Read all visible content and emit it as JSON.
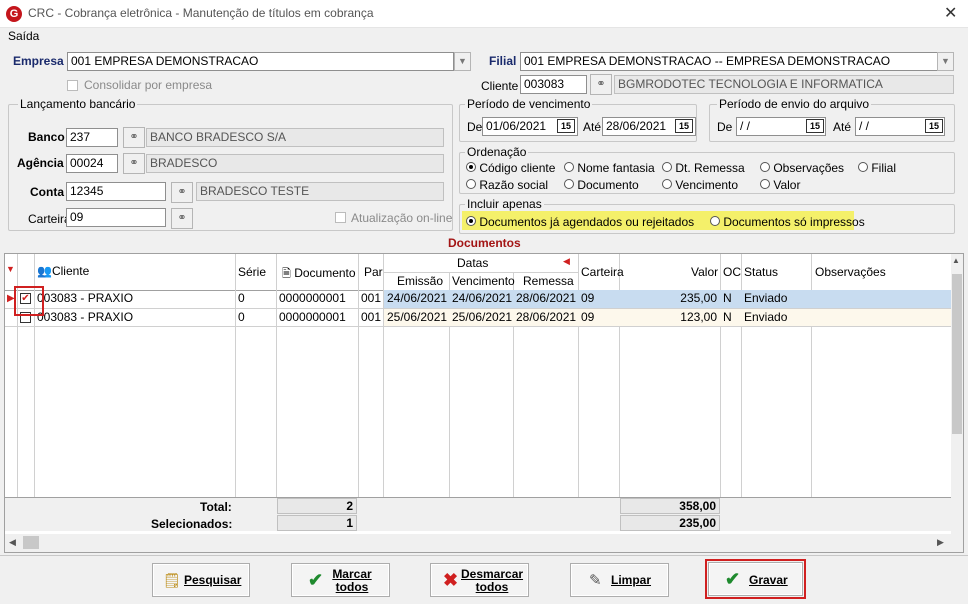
{
  "window": {
    "title": "CRC - Cobrança eletrônica - Manutenção de títulos em cobrança",
    "logo": "G"
  },
  "menu": {
    "saida": "Saída"
  },
  "empresa": {
    "label": "Empresa",
    "value": "001 EMPRESA DEMONSTRACAO",
    "consolidar_label": "Consolidar por empresa"
  },
  "filial": {
    "label": "Filial",
    "value": "001 EMPRESA DEMONSTRACAO -- EMPRESA DEMONSTRACAO"
  },
  "cliente": {
    "label": "Cliente",
    "code": "003083",
    "name": "BGMRODOTEC TECNOLOGIA  E INFORMATICA"
  },
  "lancamento": {
    "legend": "Lançamento bancário",
    "banco_label": "Banco",
    "banco_code": "237",
    "banco_name": "BANCO BRADESCO S/A",
    "agencia_label": "Agência",
    "agencia_code": "00024",
    "agencia_name": "BRADESCO",
    "conta_label": "Conta",
    "conta_code": "12345",
    "conta_name": "BRADESCO TESTE",
    "carteira_label": "Carteira",
    "carteira_code": "09",
    "atualizacao_label": "Atualização on-line"
  },
  "periodo_vencimento": {
    "legend": "Período de vencimento",
    "de_label": "De",
    "de": "01/06/2021",
    "ate_label": "Até",
    "ate": "28/06/2021"
  },
  "periodo_envio": {
    "legend": "Período de envio do arquivo",
    "de_label": "De",
    "de": " / /",
    "ate_label": "Até",
    "ate": " / /"
  },
  "calendar_icon_text": "15",
  "ordenacao": {
    "legend": "Ordenação",
    "options": [
      "Código cliente",
      "Nome fantasia",
      "Dt. Remessa",
      "Observações",
      "Filial",
      "Razão social",
      "Documento",
      "Vencimento",
      "Valor"
    ],
    "selected": "Código cliente"
  },
  "incluir": {
    "legend": "Incluir apenas",
    "opt1": "Documentos já agendados ou rejeitados",
    "opt2": "Documentos só impressos",
    "selected": "Documentos já agendados ou rejeitados"
  },
  "documentos_title": "Documentos",
  "grid": {
    "headers": {
      "cliente": "Cliente",
      "serie": "Série",
      "documento": "Documento",
      "par": "Par",
      "datas": "Datas",
      "emissao": "Emissão",
      "vencimento": "Vencimento",
      "remessa": "Remessa",
      "carteira": "Carteira",
      "valor": "Valor",
      "oc": "OC",
      "status": "Status",
      "observacoes": "Observações"
    },
    "rows": [
      {
        "checked": true,
        "cliente": "003083 - PRAXIO",
        "serie": "0",
        "documento": "0000000001",
        "par": "001",
        "emissao": "24/06/2021",
        "vencimento": "24/06/2021",
        "remessa": "28/06/2021",
        "carteira": "09",
        "valor": "235,00",
        "oc": "N",
        "status": "Enviado",
        "observacoes": ""
      },
      {
        "checked": false,
        "cliente": "003083 - PRAXIO",
        "serie": "0",
        "documento": "0000000001",
        "par": "001",
        "emissao": "25/06/2021",
        "vencimento": "25/06/2021",
        "remessa": "28/06/2021",
        "carteira": "09",
        "valor": "123,00",
        "oc": "N",
        "status": "Enviado",
        "observacoes": ""
      }
    ],
    "totals": {
      "total_label": "Total:",
      "total_count": "2",
      "total_value": "358,00",
      "sel_label": "Selecionados:",
      "sel_count": "1",
      "sel_value": "235,00"
    }
  },
  "buttons": {
    "pesquisar": "Pesquisar",
    "marcar": "Marcar todos",
    "marcar_l1": "Marcar",
    "marcar_l2": "todos",
    "desmarcar_l1": "Desmarcar",
    "desmarcar_l2": "todos",
    "limpar": "Limpar",
    "gravar": "Gravar"
  },
  "colors": {
    "accent_red": "#d02020",
    "highlight_yellow": "#f4f06a",
    "selected_row": "#c8dcf0",
    "alt_row": "#fdf8ec",
    "doc_title": "#a31515"
  }
}
